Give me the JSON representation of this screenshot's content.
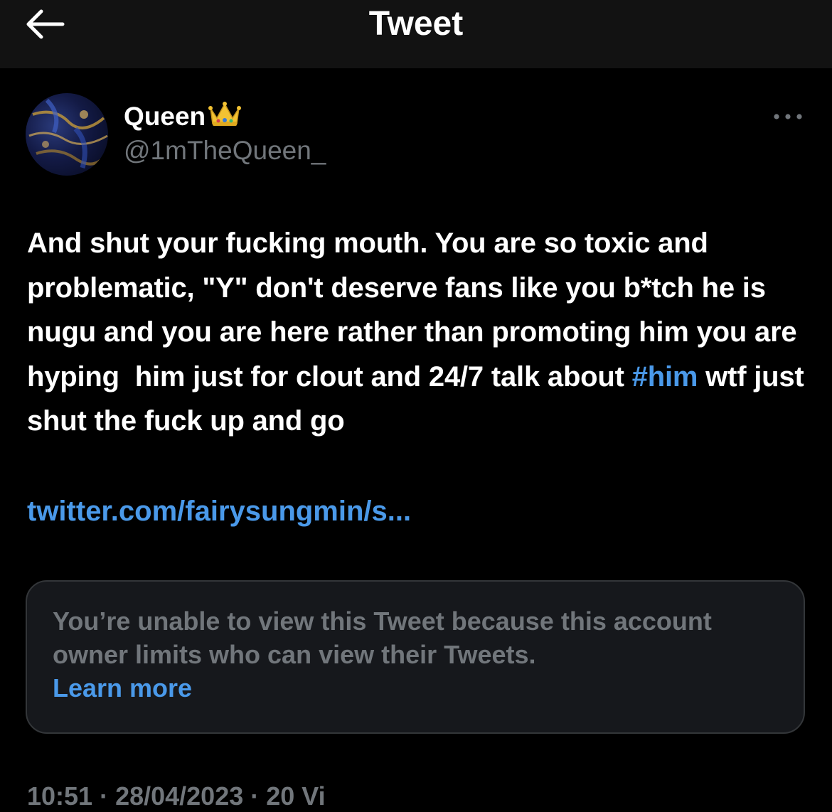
{
  "header": {
    "back_icon": "arrow-left-icon",
    "title": "Tweet"
  },
  "tweet": {
    "author": {
      "name": "Queen",
      "name_emoji": "crown-icon",
      "handle": "@1mTheQueen_"
    },
    "more_icon": "more-horizontal-icon",
    "text_before_hashtag": "And shut your fucking mouth. You are so toxic and problematic, \"Y\" don't deserve fans like you b*tch he is nugu and you are here rather than promoting him you are hyping  him just for clout and 24/7 talk about ",
    "hashtag": "#him",
    "text_after_hashtag": " wtf just shut the fuck up and go",
    "link": "twitter.com/fairysungmin/s...",
    "quote_card": {
      "message": "You’re unable to view this Tweet because this account owner limits who can view their Tweets.",
      "learn_more": "Learn more"
    },
    "timestamp": "10:51 · 28/04/2023 · 20 Vi"
  },
  "colors": {
    "background": "#000000",
    "header_background": "#121212",
    "primary_text": "#ffffff",
    "secondary_text": "#71767b",
    "link": "#4a99e9",
    "card_background": "#16181c",
    "card_border": "#333639"
  }
}
